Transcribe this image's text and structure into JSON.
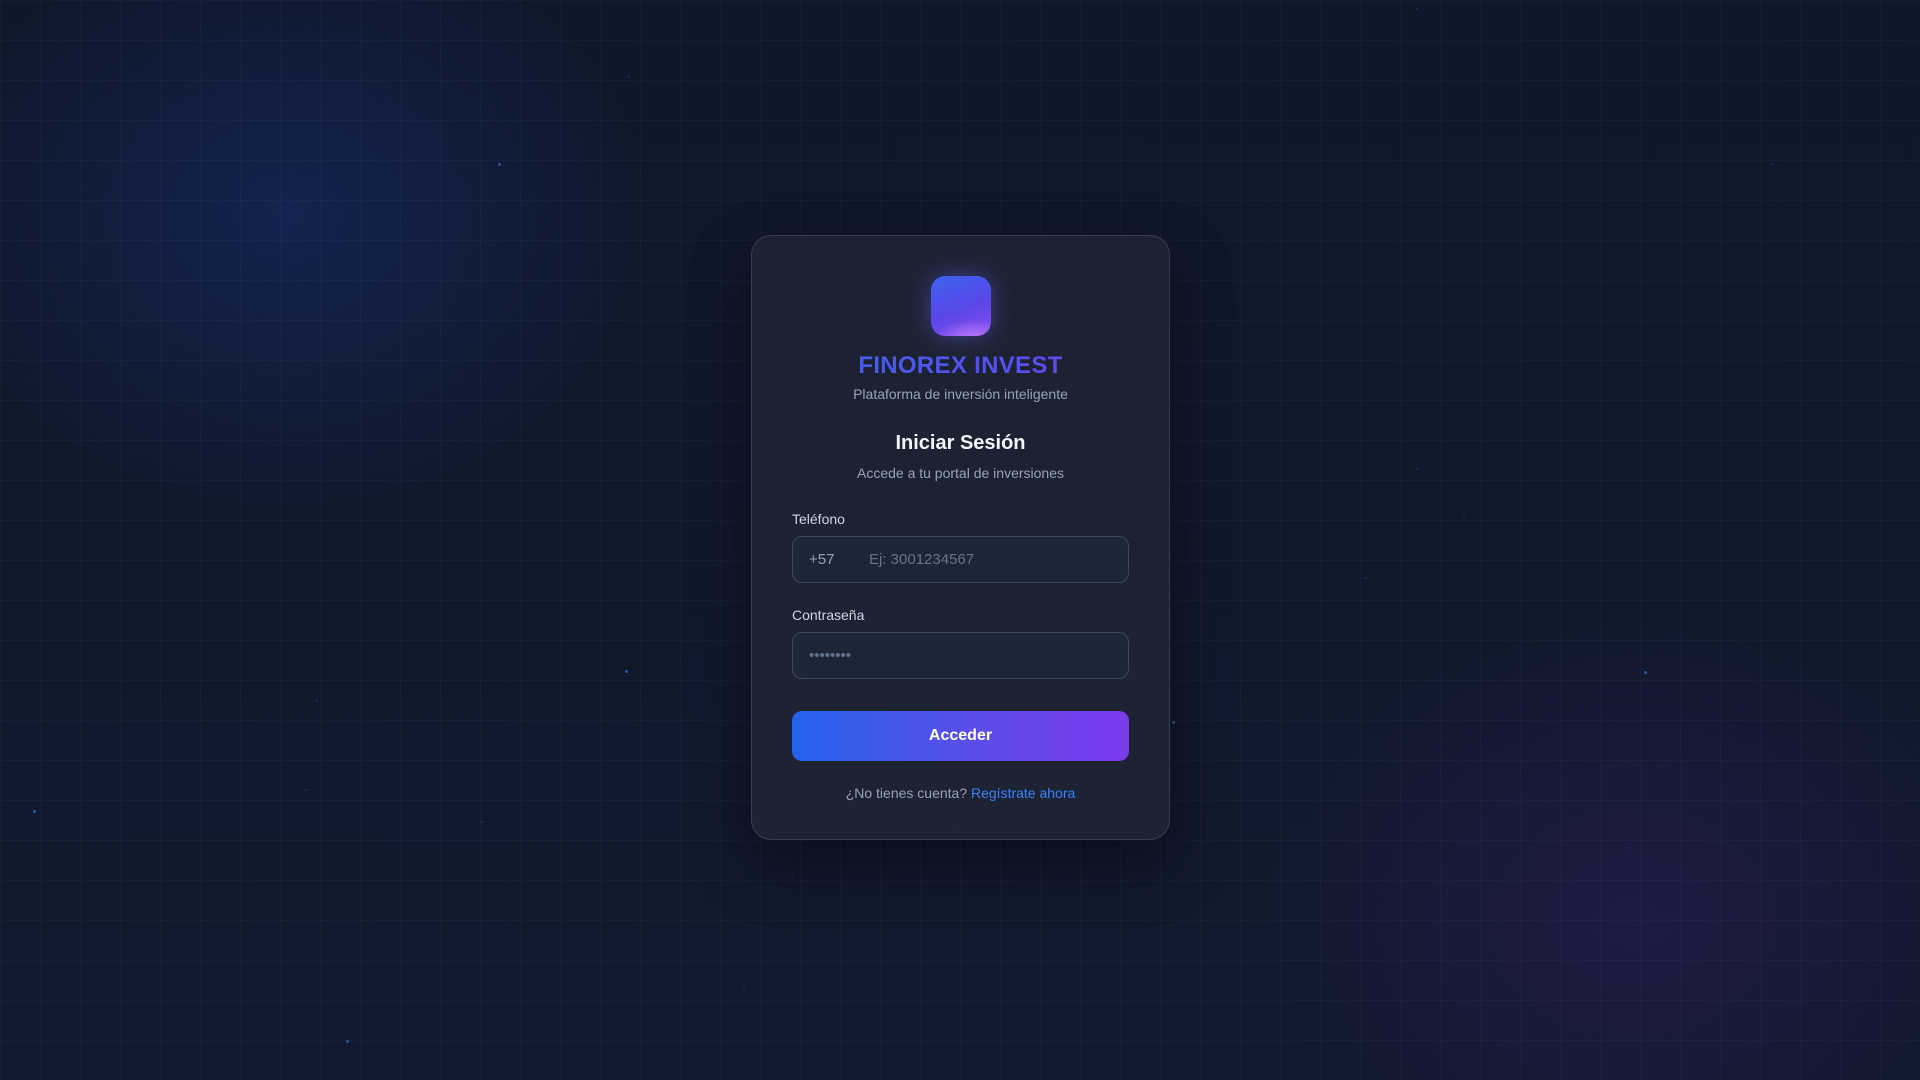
{
  "brand": {
    "name": "FINOREX INVEST",
    "tagline": "Plataforma de inversión inteligente",
    "logo_icon": "app-logo-icon"
  },
  "login": {
    "title": "Iniciar Sesión",
    "subtitle": "Accede a tu portal de inversiones",
    "phone": {
      "label": "Teléfono",
      "prefix": "+57",
      "placeholder": "Ej: 3001234567",
      "value": ""
    },
    "password": {
      "label": "Contraseña",
      "placeholder": "••••••••",
      "value": ""
    },
    "submit_label": "Acceder",
    "signup_prompt": "¿No tienes cuenta?",
    "signup_link": "Regístrate ahora"
  },
  "colors": {
    "background": "#0f172a",
    "card": "#1e2434",
    "accent_blue": "#2563eb",
    "accent_purple": "#7c3aed",
    "link": "#3b82f6"
  }
}
